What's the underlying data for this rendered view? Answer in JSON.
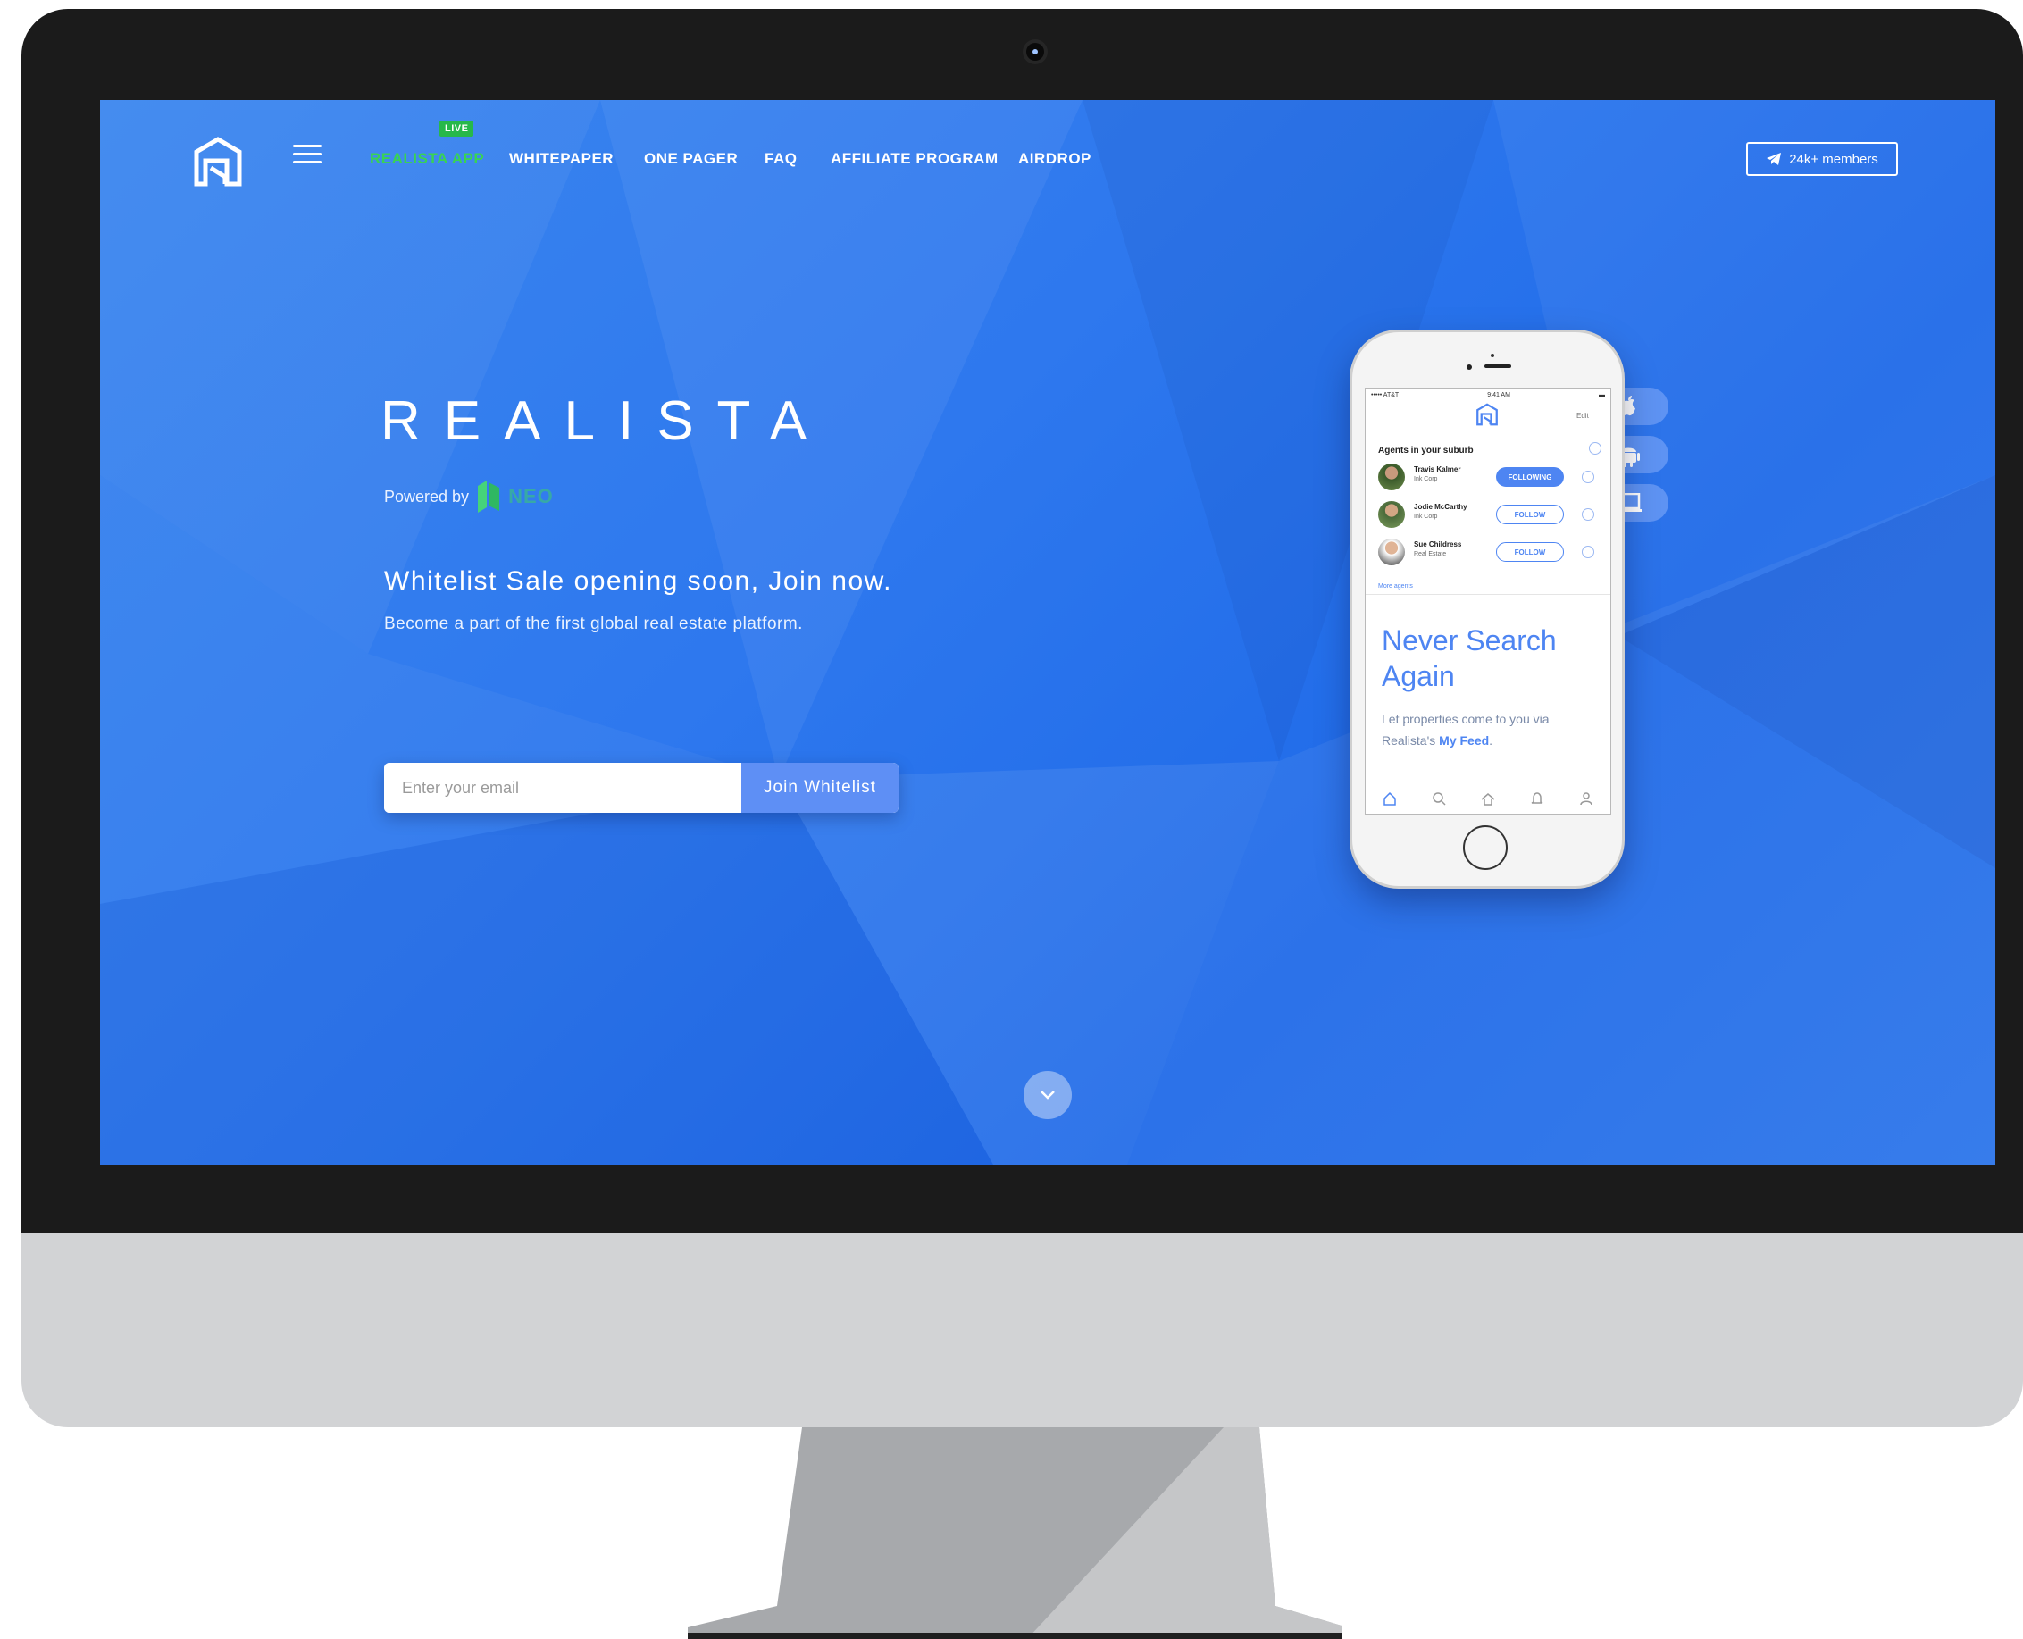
{
  "nav": {
    "live_badge": "LIVE",
    "items": [
      {
        "label": "REALISTA APP"
      },
      {
        "label": "WHITEPAPER"
      },
      {
        "label": "ONE PAGER"
      },
      {
        "label": "FAQ"
      },
      {
        "label": "AFFILIATE PROGRAM"
      },
      {
        "label": "AIRDROP"
      }
    ],
    "telegram": {
      "label": "24k+ members",
      "icon": "telegram-icon"
    }
  },
  "hero": {
    "brand": "REALISTA",
    "powered_by": "Powered by",
    "partner": "NEO",
    "headline": "Whitelist Sale opening soon, Join now.",
    "subline": "Become a part of the first global real estate platform.",
    "email_placeholder": "Enter your email",
    "join_label": "Join Whitelist"
  },
  "phone": {
    "status_left": "••••• AT&T",
    "status_time": "9:41 AM",
    "edit": "Edit",
    "agents_title": "Agents in your suburb",
    "agents": [
      {
        "name": "Travis Kalmer",
        "company": "Ink Corp",
        "action": "FOLLOWING",
        "following": true
      },
      {
        "name": "Jodie McCarthy",
        "company": "Ink Corp",
        "action": "FOLLOW",
        "following": false
      },
      {
        "name": "Sue Childress",
        "company": "Real Estate",
        "action": "FOLLOW",
        "following": false
      }
    ],
    "more_agents": "More agents",
    "promo_title": "Never Search Again",
    "promo_text_prefix": "Let properties come to you via Realista's",
    "promo_link": "My Feed",
    "tabs": [
      "home-icon",
      "search-icon",
      "house-icon",
      "bell-icon",
      "profile-icon"
    ]
  },
  "stores": [
    "apple-icon",
    "android-icon",
    "desktop-icon"
  ],
  "colors": {
    "accent": "#4e85f2",
    "live": "#39d353",
    "bezel": "#1b1b1b",
    "chin": "#d2d3d5"
  }
}
